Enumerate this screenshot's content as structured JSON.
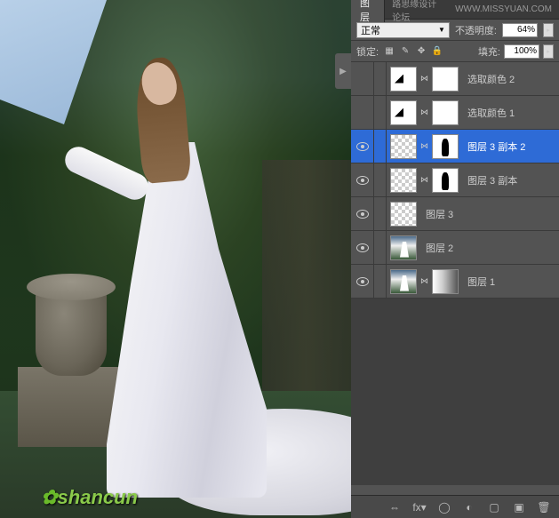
{
  "tabs": {
    "active": "图层",
    "link1": "路思缘设计论坛",
    "link2": "WWW.MISSYUAN.COM"
  },
  "blend": {
    "mode": "正常",
    "opacity_label": "不透明度:",
    "opacity_value": "64%"
  },
  "lock": {
    "label": "锁定:",
    "fill_label": "填充:",
    "fill_value": "100%"
  },
  "layers": [
    {
      "name": "选取颜色 2",
      "type": "adjustment",
      "visible": false,
      "selected": false
    },
    {
      "name": "选取颜色 1",
      "type": "adjustment",
      "visible": false,
      "selected": false
    },
    {
      "name": "图层 3 副本 2",
      "type": "masked-figure",
      "visible": true,
      "selected": true
    },
    {
      "name": "图层 3 副本",
      "type": "masked-figure",
      "visible": true,
      "selected": false
    },
    {
      "name": "图层 3",
      "type": "plain-checker",
      "visible": true,
      "selected": false
    },
    {
      "name": "图层 2",
      "type": "image",
      "visible": true,
      "selected": false
    },
    {
      "name": "图层 1",
      "type": "image-gradmask",
      "visible": true,
      "selected": false
    }
  ],
  "watermark": "shancun"
}
